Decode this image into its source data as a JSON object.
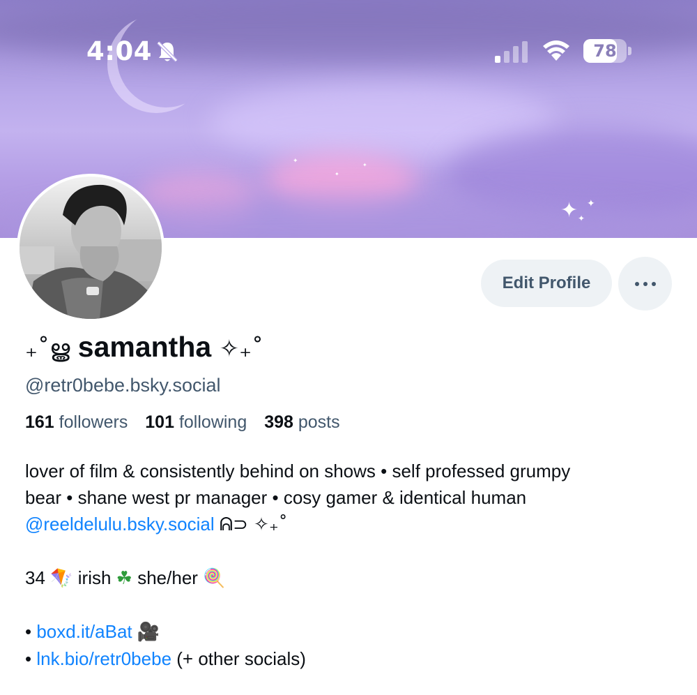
{
  "status_bar": {
    "time": "4:04",
    "battery": "78",
    "battery_level": 0.78,
    "icons": [
      "bell-slash-icon",
      "cellular-signal-icon",
      "wifi-icon",
      "battery-icon"
    ]
  },
  "profile": {
    "display_name_prefix": "₊˚ൠ",
    "display_name": "samantha",
    "display_name_suffix": "✧₊˚",
    "handle": "@retr0bebe.bsky.social",
    "stats": [
      {
        "count": "161",
        "label": "followers"
      },
      {
        "count": "101",
        "label": "following"
      },
      {
        "count": "398",
        "label": "posts"
      }
    ]
  },
  "actions": {
    "edit_profile": "Edit Profile",
    "more_icon": "ellipsis-icon"
  },
  "bio": {
    "line1": "lover of film & consistently behind on shows • self professed grumpy",
    "line2": "bear • shane west pr manager • cosy gamer & identical human",
    "mention": "@reeldelulu.bsky.social",
    "mention_suffix": "ᕱ⊃ ✧₊˚",
    "line4_prefix": "34",
    "kite_emoji": "🪁",
    "irish": "irish",
    "clover_emoji": "☘",
    "pronouns": "she/her",
    "lollipop_emoji": "🍭",
    "bullet": "•",
    "link1": "boxd.it/aBat",
    "camera_emoji": "🎥",
    "link2": "lnk.bio/retr0bebe",
    "link2_suffix": "(+ other socials)"
  },
  "colors": {
    "link": "#1083fe",
    "muted": "#42576c",
    "button_bg": "#eef2f5",
    "banner": "#b9a9ea"
  }
}
